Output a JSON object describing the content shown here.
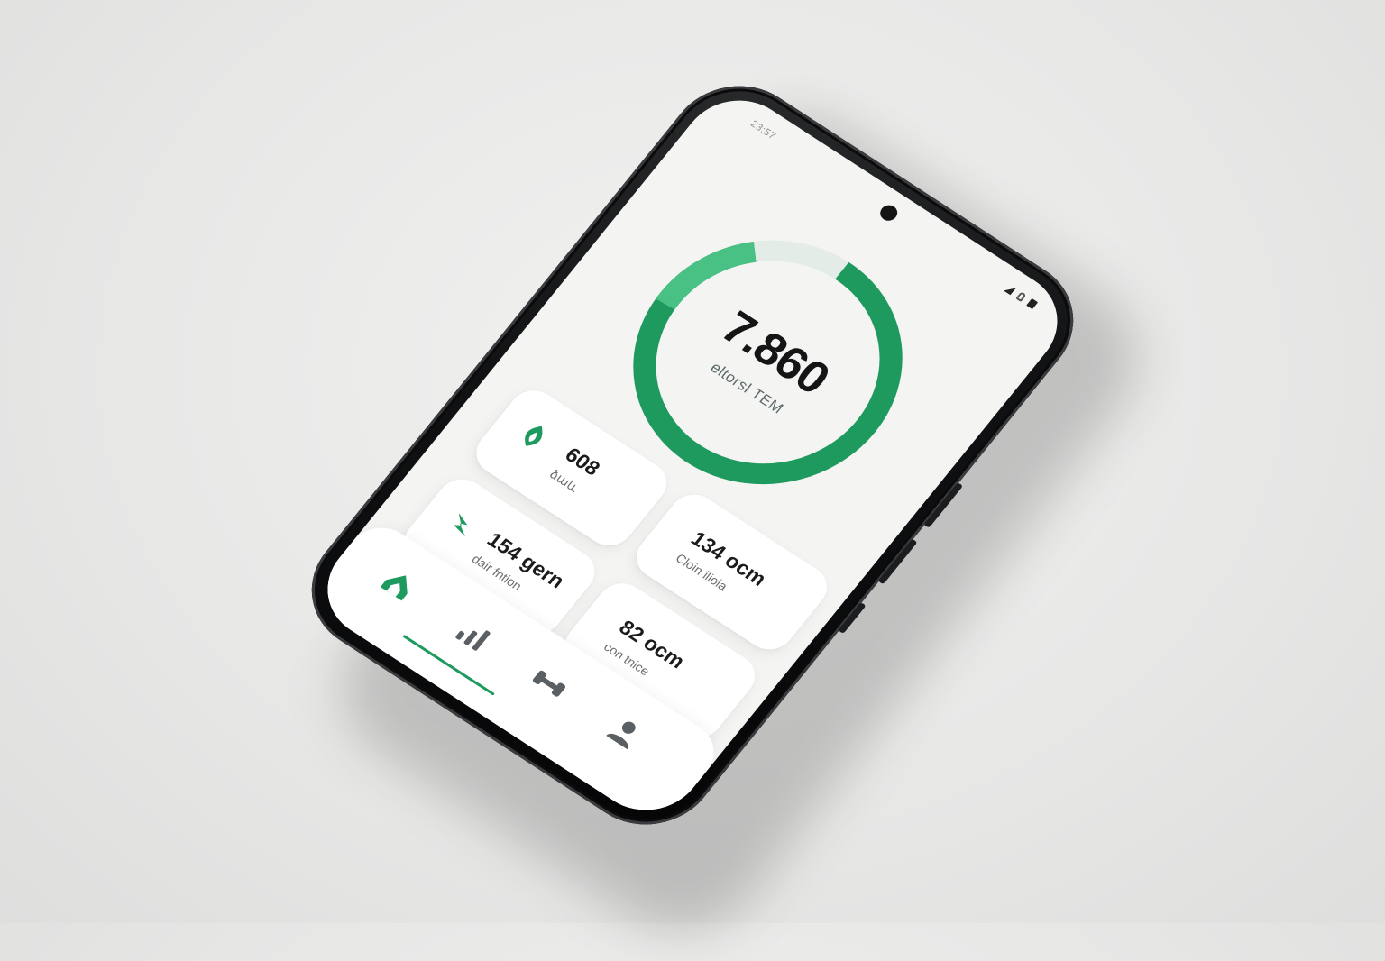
{
  "status_bar": {
    "time": "23:57"
  },
  "activity_ring": {
    "value": "7.860",
    "label": "eltorsl TEM",
    "progress": 0.88,
    "color": "#1e9a5f",
    "color_light": "#49c185"
  },
  "cards": [
    {
      "icon": "leaf-icon",
      "value": "608",
      "caption": "ձաև"
    },
    {
      "icon": "bolt-icon",
      "value": "154 gern",
      "caption": "dair fntion"
    },
    {
      "icon": "",
      "value": "134 ocm",
      "caption": "Cloin ilioia"
    },
    {
      "icon": "",
      "value": "82 ocm",
      "caption": "con tnice"
    }
  ],
  "nav": {
    "items": [
      {
        "icon": "home-icon",
        "active": true
      },
      {
        "icon": "chart-icon",
        "active": false
      },
      {
        "icon": "dumbbell-icon",
        "active": false
      },
      {
        "icon": "profile-icon",
        "active": false
      }
    ]
  },
  "colors": {
    "accent": "#1e9a5f",
    "screen_bg": "#f4f4f3",
    "card_bg": "#ffffff",
    "phone_body": "#111214"
  }
}
